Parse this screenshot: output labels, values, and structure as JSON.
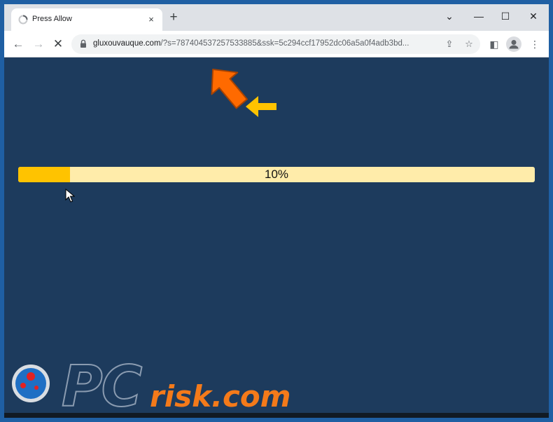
{
  "browser": {
    "tab": {
      "title": "Press Allow",
      "close_glyph": "×",
      "favicon": "spinner-favicon-icon"
    },
    "new_tab_glyph": "+",
    "window_controls": {
      "dropdown": "⌄",
      "minimize": "—",
      "maximize": "☐",
      "close": "✕"
    },
    "toolbar": {
      "back": "←",
      "forward": "→",
      "stop": "✕",
      "side_panel": "◧",
      "menu": "⋮"
    },
    "address": {
      "host": "gluxouvauque.com",
      "path": "/?s=787404537257533885&ssk=5c294ccf17952dc06a5a0f4adb3bd..."
    },
    "omnibox_actions": {
      "share": "⇪",
      "bookmark": "☆"
    }
  },
  "page": {
    "progress": {
      "percent": 10,
      "label": "10%"
    },
    "colors": {
      "background": "#1d3b5d",
      "progress_fill": "#ffc300",
      "progress_track": "#ffecaa",
      "big_arrow": "#ff6a00",
      "small_arrow": "#ffc300"
    }
  },
  "watermark": {
    "brand_pc": "PC",
    "brand_risk": "risk.com"
  }
}
